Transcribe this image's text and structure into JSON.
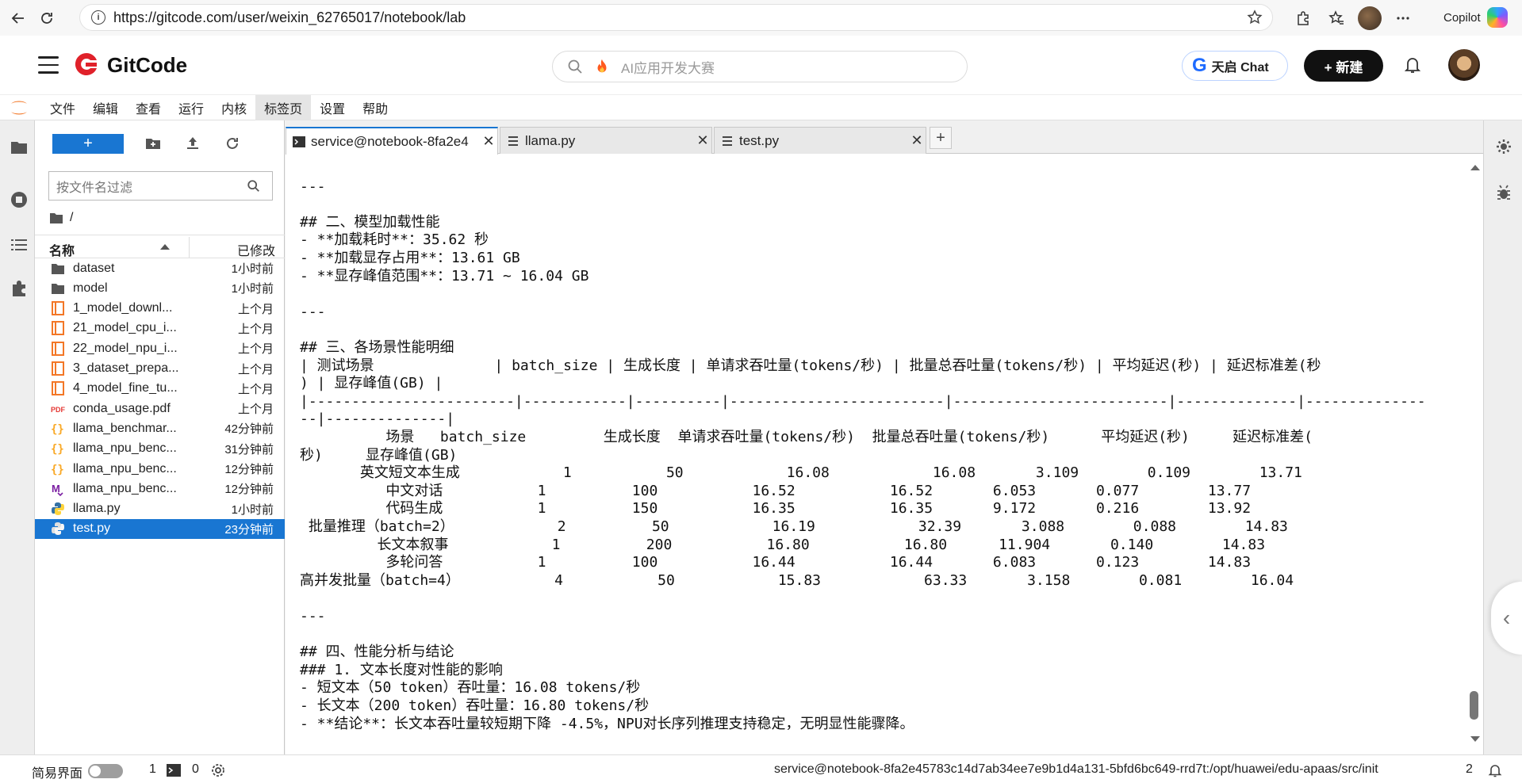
{
  "browser": {
    "url": "https://gitcode.com/user/weixin_62765017/notebook/lab",
    "copilot_label": "Copilot"
  },
  "site": {
    "brand": "GitCode",
    "search_placeholder": "AI应用开发大赛",
    "tq_label": "天启 Chat",
    "new_label": "+ 新建"
  },
  "menu": [
    "文件",
    "编辑",
    "查看",
    "运行",
    "内核",
    "标签页",
    "设置",
    "帮助"
  ],
  "file_panel": {
    "filter_placeholder": "按文件名过滤",
    "breadcrumb": "/",
    "col_name": "名称",
    "col_modified": "已修改",
    "files": [
      {
        "name": "dataset",
        "modified": "1小时前",
        "icon": "folder-icon"
      },
      {
        "name": "model",
        "modified": "1小时前",
        "icon": "folder-icon"
      },
      {
        "name": "1_model_downl...",
        "modified": "上个月",
        "icon": "notebook-icon"
      },
      {
        "name": "21_model_cpu_i...",
        "modified": "上个月",
        "icon": "notebook-icon"
      },
      {
        "name": "22_model_npu_i...",
        "modified": "上个月",
        "icon": "notebook-icon"
      },
      {
        "name": "3_dataset_prepa...",
        "modified": "上个月",
        "icon": "notebook-icon"
      },
      {
        "name": "4_model_fine_tu...",
        "modified": "上个月",
        "icon": "notebook-icon"
      },
      {
        "name": "conda_usage.pdf",
        "modified": "上个月",
        "icon": "pdf-icon"
      },
      {
        "name": "llama_benchmar...",
        "modified": "42分钟前",
        "icon": "json-icon"
      },
      {
        "name": "llama_npu_benc...",
        "modified": "31分钟前",
        "icon": "json-icon"
      },
      {
        "name": "llama_npu_benc...",
        "modified": "12分钟前",
        "icon": "json-icon"
      },
      {
        "name": "llama_npu_benc...",
        "modified": "12分钟前",
        "icon": "markdown-icon"
      },
      {
        "name": "llama.py",
        "modified": "1小时前",
        "icon": "python-icon"
      },
      {
        "name": "test.py",
        "modified": "23分钟前",
        "icon": "python-icon",
        "selected": true
      }
    ]
  },
  "tabs": [
    {
      "label": "service@notebook-8fa2e4",
      "icon": "terminal-icon",
      "active": true
    },
    {
      "label": "llama.py",
      "icon": "text-file-icon",
      "active": false
    },
    {
      "label": "test.py",
      "icon": "text-file-icon",
      "active": false
    }
  ],
  "terminal_lines": [
    "",
    "---",
    "",
    "## 二、模型加载性能",
    "- **加载耗时**：35.62 秒",
    "- **加载显存占用**：13.61 GB",
    "- **显存峰值范围**：13.71 ~ 16.04 GB",
    "",
    "---",
    "",
    "## 三、各场景性能明细",
    "| 测试场景              | batch_size | 生成长度 | 单请求吞吐量(tokens/秒) | 批量总吞吐量(tokens/秒) | 平均延迟(秒) | 延迟标准差(秒",
    ") | 显存峰值(GB) |",
    "|------------------------|------------|----------|-------------------------|-------------------------|--------------|--------------",
    "--|--------------|",
    "          场景   batch_size         生成长度  单请求吞吐量(tokens/秒)  批量总吞吐量(tokens/秒)      平均延迟(秒)     延迟标准差(",
    "秒)     显存峰值(GB)",
    "       英文短文本生成            1           50            16.08            16.08       3.109        0.109        13.71",
    "          中文对话           1          100           16.52           16.52       6.053       0.077        13.77",
    "          代码生成           1          150           16.35           16.35       9.172       0.216        13.92",
    " 批量推理（batch=2）            2          50            16.19            32.39       3.088        0.088        14.83",
    "         长文本叙事            1          200           16.80           16.80      11.904       0.140        14.83",
    "          多轮问答           1          100           16.44           16.44       6.083       0.123        14.83",
    "高并发批量（batch=4）           4           50            15.83            63.33       3.158        0.081        16.04",
    "",
    "---",
    "",
    "## 四、性能分析与结论",
    "### 1. 文本长度对性能的影响",
    "- 短文本（50 token）吞吐量：16.08 tokens/秒",
    "- 长文本（200 token）吞吐量：16.80 tokens/秒",
    "- **结论**：长文本吞吐量较短期下降 -4.5%，NPU对长序列推理支持稳定，无明显性能骤降。"
  ],
  "status": {
    "simple_mode": "简易界面",
    "count1": "1",
    "count2": "0",
    "path": "service@notebook-8fa2e45783c14d7ab34ee7e9b1d4a131-5bfd6bc649-rrd7t:/opt/huawei/edu-apaas/src/init",
    "count3": "2"
  }
}
